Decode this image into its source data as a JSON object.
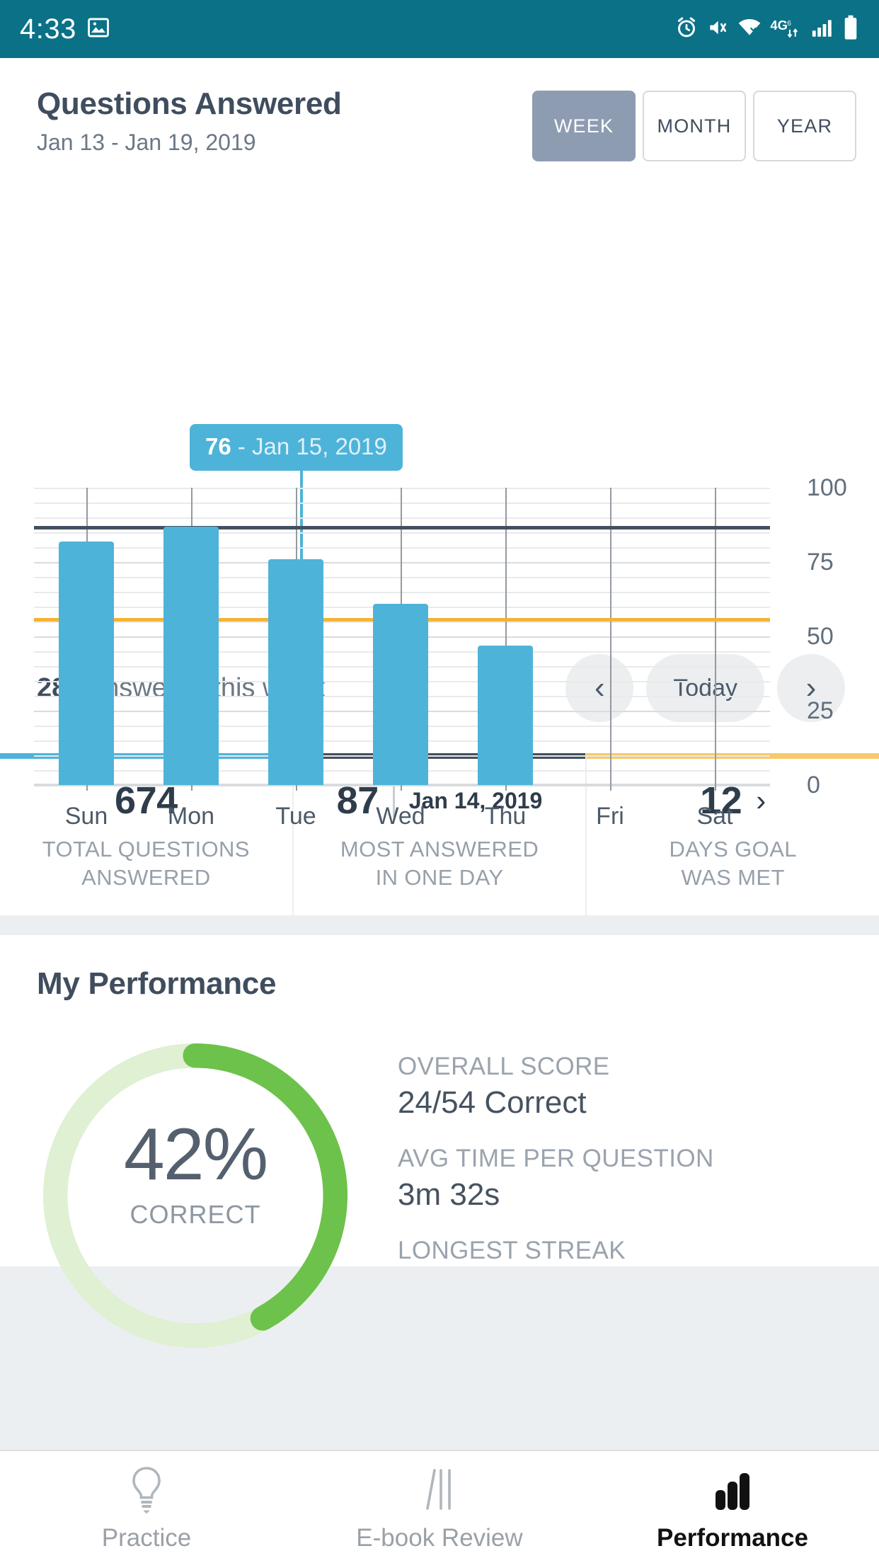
{
  "statusbar": {
    "time": "4:33",
    "left_icons": [
      "image-icon"
    ],
    "right_icons": [
      "alarm-icon",
      "vibrate-mute-icon",
      "wifi-icon",
      "4g-lte-icon",
      "signal-bars-icon",
      "battery-icon"
    ]
  },
  "header": {
    "title": "Questions Answered",
    "date_range": "Jan 13 - Jan 19, 2019",
    "segments": [
      {
        "label": "WEEK",
        "selected": true
      },
      {
        "label": "MONTH",
        "selected": false
      },
      {
        "label": "YEAR",
        "selected": false
      }
    ]
  },
  "tooltip": {
    "value": "76",
    "separator": " - ",
    "date": "Jan 15, 2019"
  },
  "weeknav": {
    "count": "286",
    "text": " answered this week",
    "prev_label": "‹",
    "today_label": "Today",
    "next_label": "›"
  },
  "stats": [
    {
      "value": "674",
      "date": "",
      "chevron": "",
      "label_line1": "TOTAL QUESTIONS",
      "label_line2": "ANSWERED",
      "accent": "#4eb3d9"
    },
    {
      "value": "87",
      "date": "Jan 14, 2019",
      "chevron": "",
      "label_line1": "MOST ANSWERED",
      "label_line2": "IN ONE DAY",
      "accent": "#44505f"
    },
    {
      "value": "12",
      "date": "",
      "chevron": "›",
      "label_line1": "DAYS GOAL",
      "label_line2": "WAS MET",
      "accent": "#f7c96b"
    }
  ],
  "performance": {
    "title": "My Performance",
    "donut": {
      "percent": "42%",
      "caption": "CORRECT",
      "value": 42,
      "color": "#6cc24a",
      "track_color": "#dff0d3"
    },
    "metrics": [
      {
        "label": "OVERALL SCORE",
        "value": "24/54 Correct"
      },
      {
        "label": "AVG TIME PER QUESTION",
        "value": "3m 32s"
      },
      {
        "label": "LONGEST STREAK",
        "value": ""
      }
    ]
  },
  "bottomnav": [
    {
      "label": "Practice",
      "icon": "lightbulb-icon",
      "active": false
    },
    {
      "label": "E-book Review",
      "icon": "bookmark-lines-icon",
      "active": false
    },
    {
      "label": "Performance",
      "icon": "bar-chart-icon",
      "active": true
    }
  ],
  "chart_data": {
    "type": "bar",
    "title": "Questions Answered",
    "subtitle": "Jan 13 - Jan 19, 2019",
    "categories": [
      "Sun",
      "Mon",
      "Tue",
      "Wed",
      "Thu",
      "Fri",
      "Sat"
    ],
    "values": [
      82,
      87,
      76,
      61,
      47,
      0,
      0
    ],
    "xlabel": "",
    "ylabel": "",
    "ylim": [
      0,
      100
    ],
    "yticks": [
      0,
      25,
      50,
      75,
      100
    ],
    "ytick_labels": [
      "0",
      "25",
      "50",
      "75",
      "100"
    ],
    "grid": true,
    "bar_color": "#4eb3d9",
    "reference_lines": [
      {
        "name": "most answered in one day",
        "value": 87,
        "color": "#44505f"
      },
      {
        "name": "daily goal",
        "value": 56,
        "color": "#f5b335"
      }
    ],
    "highlight": {
      "category": "Tue",
      "value": 76,
      "label": "76 - Jan 15, 2019"
    },
    "total_label": "286 answered this week",
    "legend": []
  }
}
